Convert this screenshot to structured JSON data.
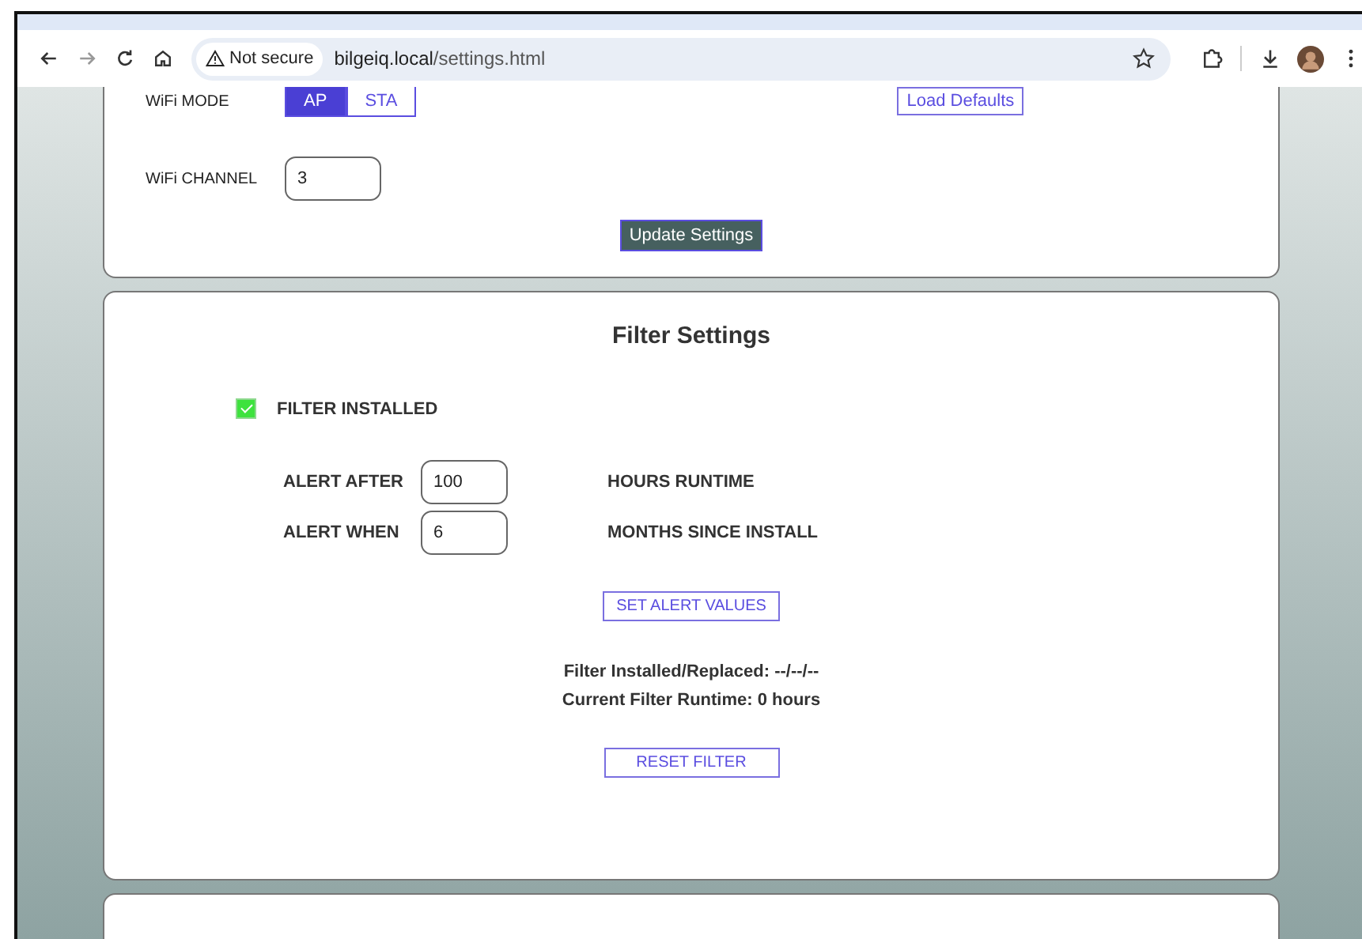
{
  "browser": {
    "security": "Not secure",
    "url_host": "bilgeiq.local",
    "url_path": "/settings.html"
  },
  "network_card": {
    "wifi_mode": {
      "label": "WiFi MODE",
      "options": [
        {
          "label": "AP",
          "selected": true
        },
        {
          "label": "STA",
          "selected": false
        }
      ]
    },
    "load_defaults": "Load Defaults",
    "wifi_channel": {
      "label": "WiFi CHANNEL",
      "value": "3"
    },
    "update_button": "Update Settings"
  },
  "filter_card": {
    "title": "Filter Settings",
    "filter_installed": {
      "label": "FILTER INSTALLED",
      "checked": true
    },
    "alerts": [
      {
        "label": "ALERT AFTER",
        "value": "100",
        "unit": "HOURS RUNTIME"
      },
      {
        "label": "ALERT WHEN",
        "value": "6",
        "unit": "MONTHS SINCE INSTALL"
      }
    ],
    "set_button": "SET ALERT VALUES",
    "installed_replaced": "Filter Installed/Replaced: --/--/--",
    "runtime": "Current Filter Runtime: 0 hours",
    "reset_button": "RESET FILTER"
  }
}
